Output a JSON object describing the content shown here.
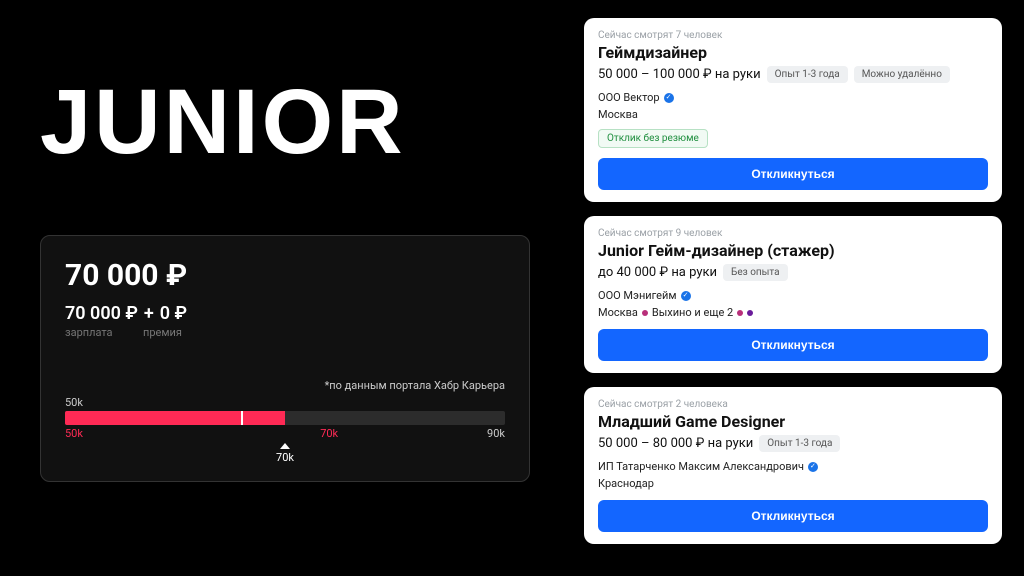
{
  "title": "JUNIOR",
  "salary_card": {
    "total": "70 000 ₽",
    "base": "70 000 ₽",
    "plus": "+",
    "bonus": "0 ₽",
    "base_label": "зарплата",
    "bonus_label": "премия",
    "source": "*по данным портала Хабр Карьера",
    "axis_start": "50k",
    "tick_low": "50k",
    "tick_high": "70k",
    "tick_max": "90k",
    "marker_label": "70k",
    "fill_pct": 50,
    "median_pct": 40,
    "tick_high_pct": 58,
    "marker_pct": 50
  },
  "jobs": [
    {
      "viewers": "Сейчас смотрят 7 человек",
      "title": "Геймдизайнер",
      "salary": "50 000 – 100 000 ₽ на руки",
      "tags": [
        "Опыт 1-3 года",
        "Можно удалённо"
      ],
      "company": "ООО Вектор",
      "location": "Москва",
      "metro": [],
      "green_badge": "Отклик без резюме",
      "apply": "Откликнуться"
    },
    {
      "viewers": "Сейчас смотрят 9 человек",
      "title": "Junior Гейм-дизайнер (стажер)",
      "salary": "до 40 000 ₽ на руки",
      "tags": [
        "Без опыта"
      ],
      "company": "ООО Мэнигейм",
      "location": "Москва",
      "metro_text": "Выхино и еще 2",
      "metro": [
        "#b82f7a",
        "#b82f7a",
        "#6a1b9a"
      ],
      "apply": "Откликнуться"
    },
    {
      "viewers": "Сейчас смотрят 2 человека",
      "title": "Младший Game Designer",
      "salary": "50 000 – 80 000 ₽ на руки",
      "tags": [
        "Опыт 1-3 года"
      ],
      "company": "ИП Татарченко Максим Александрович",
      "location": "Краснодар",
      "metro": [],
      "apply": "Откликнуться"
    }
  ]
}
